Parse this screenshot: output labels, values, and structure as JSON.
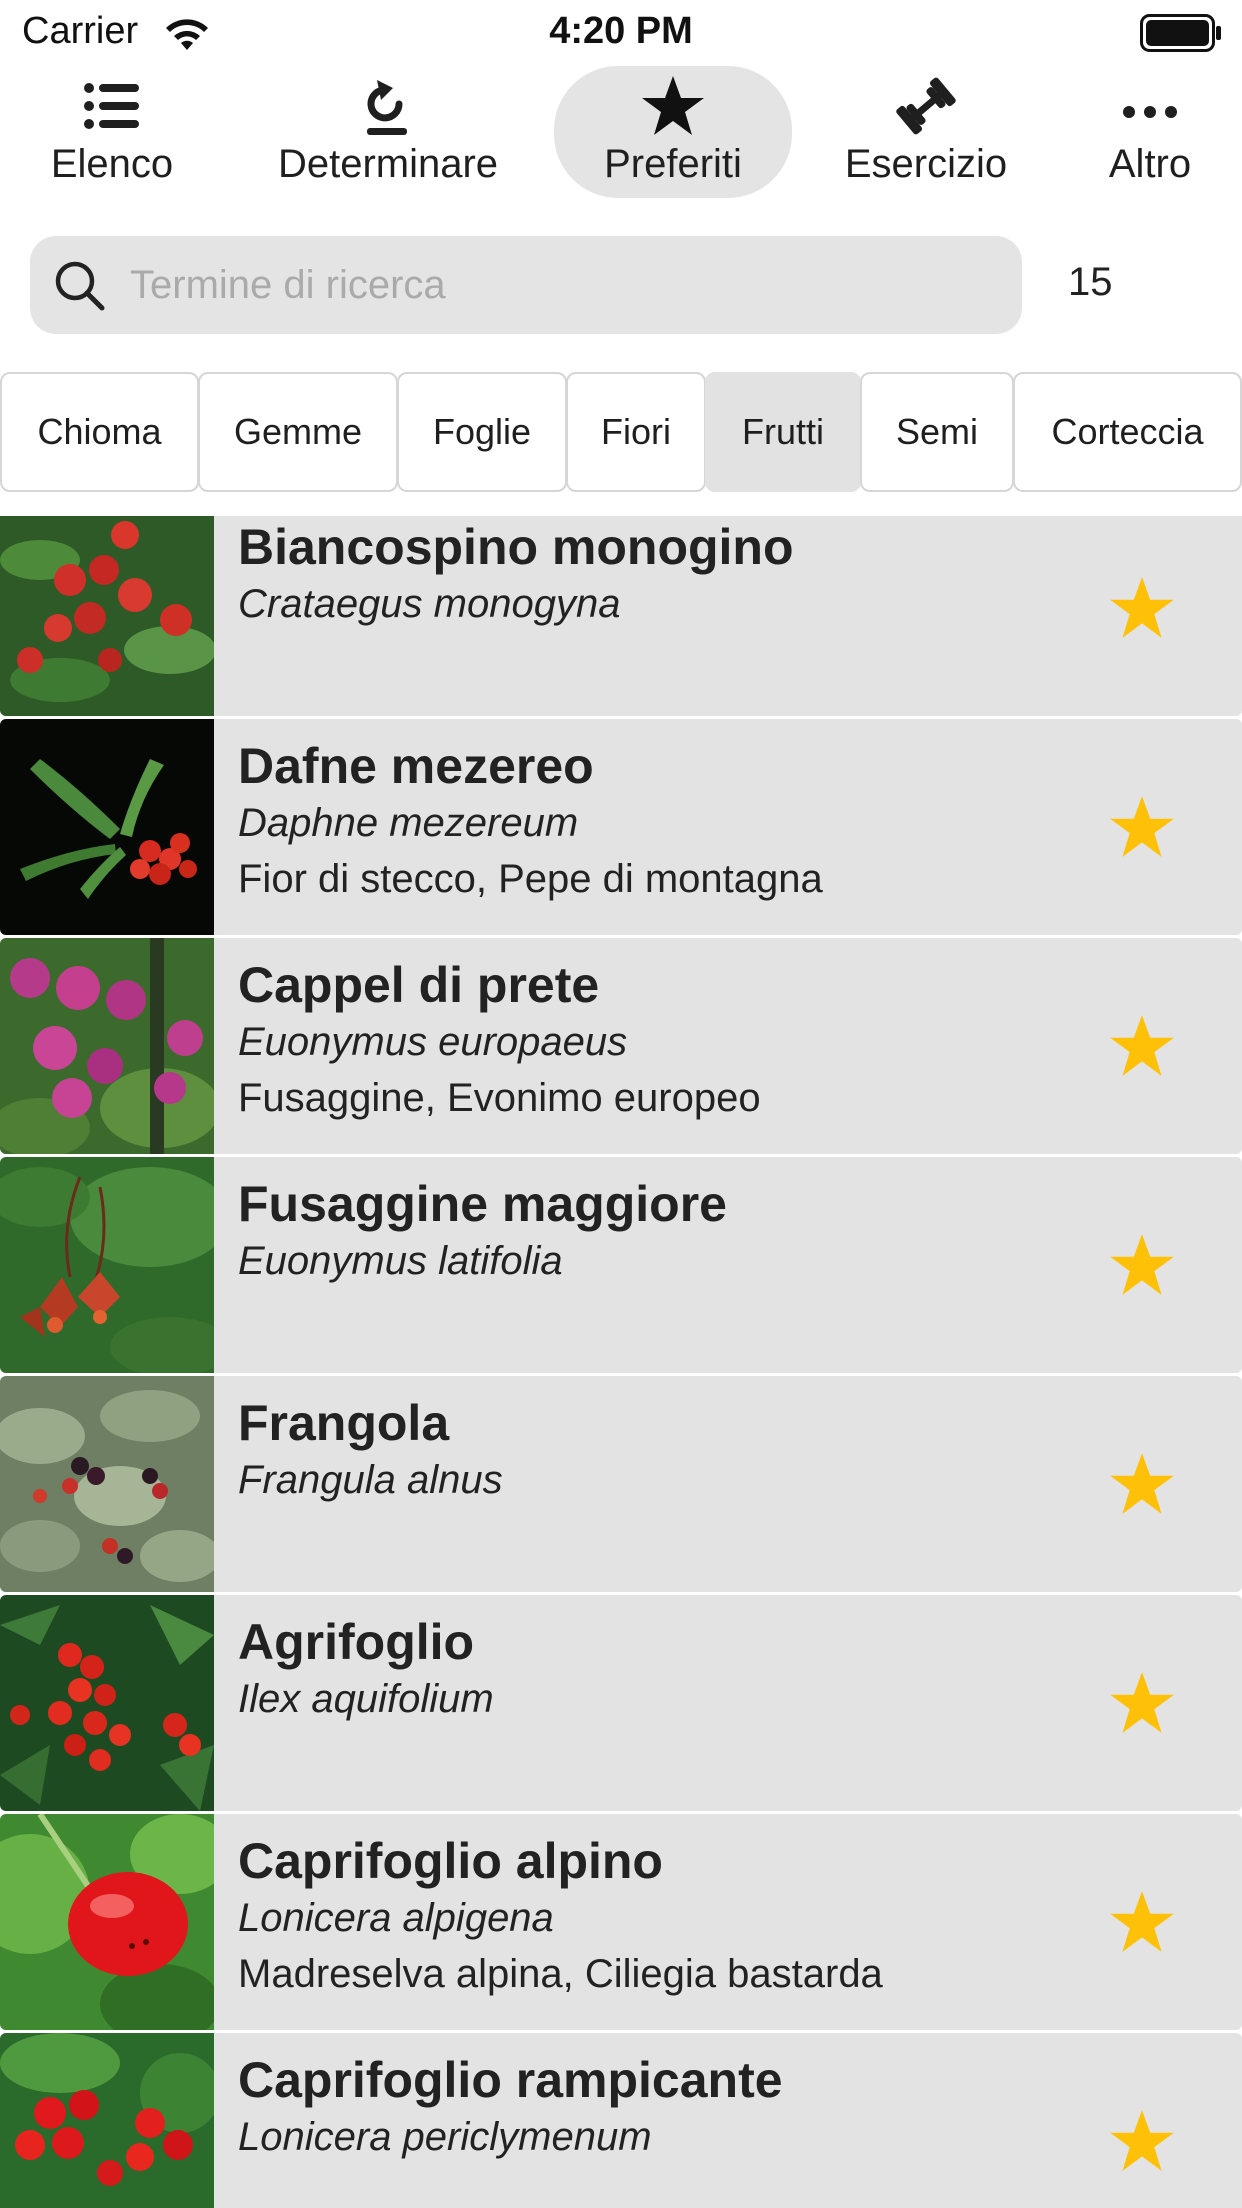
{
  "status_bar": {
    "carrier": "Carrier",
    "time": "4:20 PM",
    "wifi_icon": "wifi-icon",
    "battery_icon": "battery-full-icon"
  },
  "toolbar": {
    "items": [
      {
        "label": "Elenco",
        "icon": "list-icon"
      },
      {
        "label": "Determinare",
        "icon": "identify-arrow-icon"
      },
      {
        "label": "Preferiti",
        "icon": "star-icon",
        "active": true
      },
      {
        "label": "Esercizio",
        "icon": "dumbbell-icon"
      },
      {
        "label": "Altro",
        "icon": "more-icon"
      }
    ]
  },
  "search": {
    "placeholder": "Termine di ricerca",
    "value": "",
    "count": "15"
  },
  "filters": {
    "items": [
      "Chioma",
      "Gemme",
      "Foglie",
      "Fiori",
      "Frutti",
      "Semi",
      "Corteccia"
    ],
    "selected": "Frutti"
  },
  "colors": {
    "accent_star": "#FFC107",
    "row_background": "#E3E3E3",
    "selected_segment": "#E2E2E2"
  },
  "list": {
    "items": [
      {
        "common": "Biancospino monogino",
        "scientific": "Crataegus monogyna",
        "synonyms": "",
        "favorite": true
      },
      {
        "common": "Dafne mezereo",
        "scientific": "Daphne mezereum",
        "synonyms": "Fior di stecco, Pepe di montagna",
        "favorite": true
      },
      {
        "common": "Cappel di prete",
        "scientific": "Euonymus europaeus",
        "synonyms": "Fusaggine, Evonimo europeo",
        "favorite": true
      },
      {
        "common": "Fusaggine maggiore",
        "scientific": "Euonymus latifolia",
        "synonyms": "",
        "favorite": true
      },
      {
        "common": "Frangola",
        "scientific": "Frangula alnus",
        "synonyms": "",
        "favorite": true
      },
      {
        "common": "Agrifoglio",
        "scientific": "Ilex aquifolium",
        "synonyms": "",
        "favorite": true
      },
      {
        "common": "Caprifoglio alpino",
        "scientific": "Lonicera alpigena",
        "synonyms": "Madreselva alpina, Ciliegia bastarda",
        "favorite": true
      },
      {
        "common": "Caprifoglio rampicante",
        "scientific": "Lonicera periclymenum",
        "synonyms": "",
        "favorite": true
      }
    ]
  }
}
